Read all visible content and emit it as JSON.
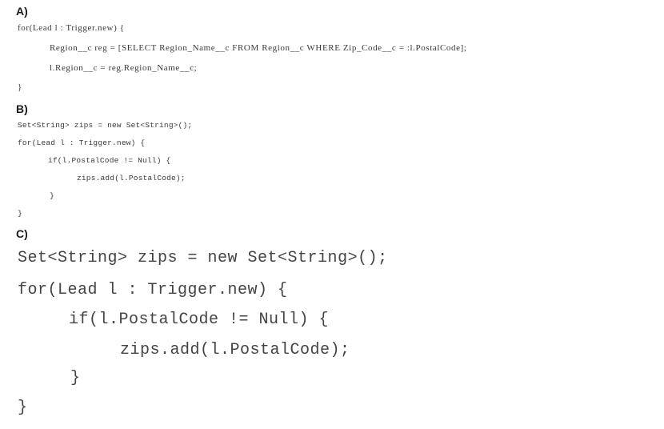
{
  "sections": [
    {
      "label": "A)",
      "lines": [
        "for(Lead l : Trigger.new) {",
        "Region__c reg = [SELECT Region_Name__c FROM Region__c WHERE Zip_Code__c = :l.PostalCode];",
        "l.Region__c = reg.Region_Name__c;",
        "}"
      ]
    },
    {
      "label": "B)",
      "lines": [
        "Set<String> zips = new Set<String>();",
        "for(Lead l : Trigger.new) {",
        "if(l.PostalCode != Null) {",
        "zips.add(l.PostalCode);",
        "}",
        "}"
      ]
    },
    {
      "label": "C)",
      "lines": [
        "Set<String> zips = new Set<String>();",
        "for(Lead l : Trigger.new) {",
        "if(l.PostalCode != Null) {",
        "zips.add(l.PostalCode);",
        "}",
        "}"
      ]
    }
  ]
}
